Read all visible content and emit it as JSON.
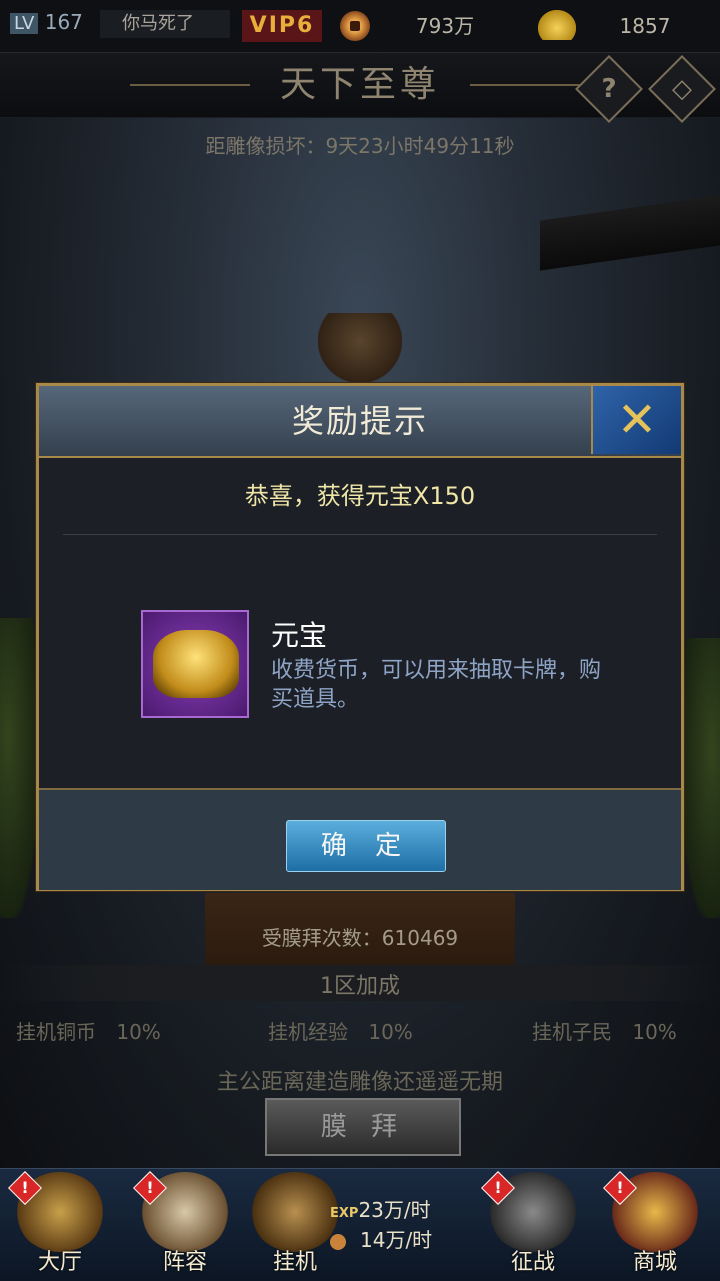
{
  "topbar": {
    "level_tag": "LV",
    "level": "167",
    "player_name": "你马死了",
    "vip": "VIP6",
    "coins": "793万",
    "gold": "1857"
  },
  "header": {
    "title": "天下至尊",
    "help_icon": "?",
    "back_icon": "◇"
  },
  "countdown": "距雕像损坏：9天23小时49分11秒",
  "modal": {
    "title": "奖励提示",
    "close_icon": "✕",
    "congrats": "恭喜，获得元宝X150",
    "item_name": "元宝",
    "item_desc": "收费货币，可以用来抽取卡牌，购买道具。",
    "ok_label": "确 定"
  },
  "worship_count": "受膜拜次数：610469",
  "bonus": {
    "title": "1区加成",
    "items": [
      {
        "label": "挂机铜币",
        "value": "10%"
      },
      {
        "label": "挂机经验",
        "value": "10%"
      },
      {
        "label": "挂机子民",
        "value": "10%"
      }
    ]
  },
  "status_text": "主公距离建造雕像还遥遥无期",
  "worship_button": "膜 拜",
  "nav": {
    "items": [
      {
        "label": "大厅",
        "badge": "!"
      },
      {
        "label": "阵容",
        "badge": "!"
      },
      {
        "label": "挂机",
        "badge": ""
      },
      {
        "label": "征战",
        "badge": "!"
      },
      {
        "label": "商城",
        "badge": "!"
      }
    ],
    "exp_rate": "23万/时",
    "exp_tag": "EXP",
    "coin_rate": "14万/时"
  },
  "colors": {
    "accent_gold": "#a8894a",
    "ok_button": "#1e6ea6",
    "vip_red": "#5a1518"
  }
}
